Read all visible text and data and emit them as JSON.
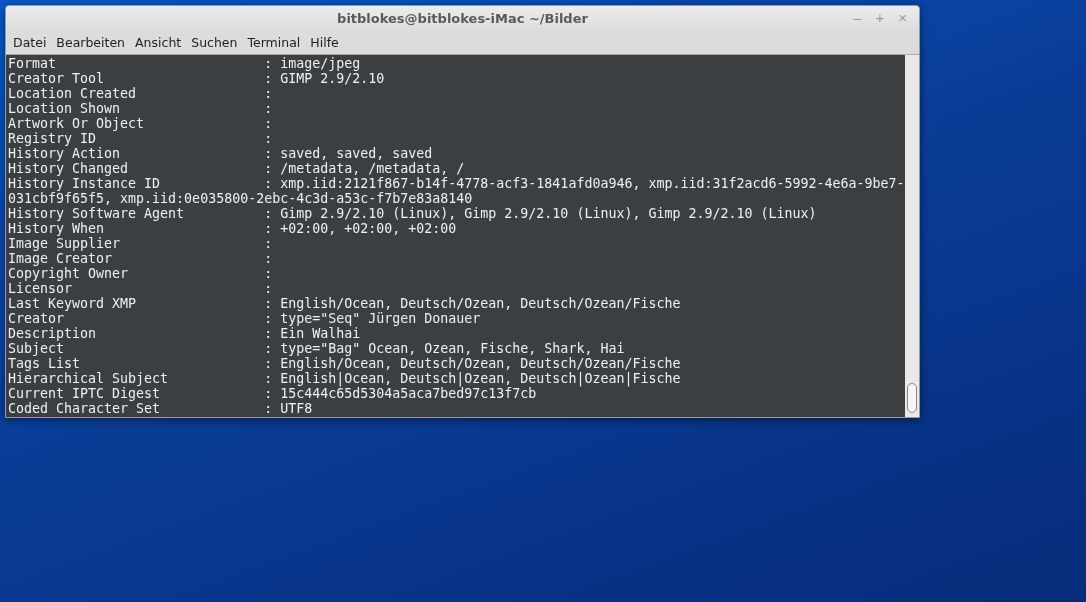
{
  "window": {
    "title": "bitblokes@bitblokes-iMac ~/Bilder",
    "controls": [
      "–",
      "+",
      "×"
    ]
  },
  "menu": [
    "Datei",
    "Bearbeiten",
    "Ansicht",
    "Suchen",
    "Terminal",
    "Hilfe"
  ],
  "terminal": {
    "lines": [
      "Format                          : image/jpeg",
      "Creator Tool                    : GIMP 2.9/2.10",
      "Location Created                :",
      "Location Shown                  :",
      "Artwork Or Object               :",
      "Registry ID                     :",
      "History Action                  : saved, saved, saved",
      "History Changed                 : /metadata, /metadata, /",
      "History Instance ID             : xmp.iid:2121f867-b14f-4778-acf3-1841afd0a946, xmp.iid:31f2acd6-5992-4e6a-9be7-",
      "031cbf9f65f5, xmp.iid:0e035800-2ebc-4c3d-a53c-f7b7e83a8140",
      "History Software Agent          : Gimp 2.9/2.10 (Linux), Gimp 2.9/2.10 (Linux), Gimp 2.9/2.10 (Linux)",
      "History When                    : +02:00, +02:00, +02:00",
      "Image Supplier                  :",
      "Image Creator                   :",
      "Copyright Owner                 :",
      "Licensor                        :",
      "Last Keyword XMP                : English/Ocean, Deutsch/Ozean, Deutsch/Ozean/Fische",
      "Creator                         : type=\"Seq\" Jürgen Donauer",
      "Description                     : Ein Walhai",
      "Subject                         : type=\"Bag\" Ocean, Ozean, Fische, Shark, Hai",
      "Tags List                       : English/Ocean, Deutsch/Ozean, Deutsch/Ozean/Fische",
      "Hierarchical Subject            : English|Ocean, Deutsch|Ozean, Deutsch|Ozean|Fische",
      "Current IPTC Digest             : 15c444c65d5304a5aca7bed97c13f7cb",
      "Coded Character Set             : UTF8"
    ]
  }
}
